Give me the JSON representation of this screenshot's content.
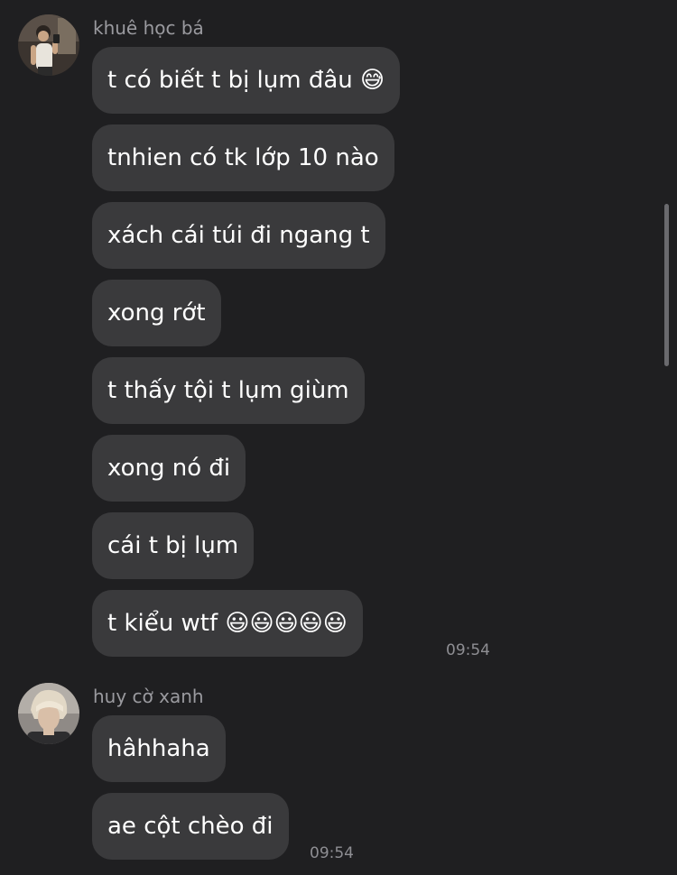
{
  "groups": [
    {
      "sender": "khuê học bá",
      "avatar_icon": "user-avatar-photo",
      "messages": [
        "t có biết t bị lụm đâu 😅",
        "tnhien có tk lớp 10 nào",
        "xách cái túi đi ngang t",
        "xong rớt",
        "t thấy tội t lụm giùm",
        "xong nó đi",
        "cái t bị lụm",
        "t kiểu wtf 😃😃😃😃😃"
      ],
      "timestamp": "09:54"
    },
    {
      "sender": "huy cờ xanh",
      "avatar_icon": "user-avatar-photo",
      "messages": [
        "hâhhaha",
        "ae cột chèo đi"
      ],
      "timestamp": "09:54"
    }
  ],
  "colors": {
    "background": "#1f1f21",
    "bubble": "#3a3a3c",
    "text": "#ffffff",
    "sender": "#9a9a9f",
    "timestamp": "#8e8e93"
  }
}
